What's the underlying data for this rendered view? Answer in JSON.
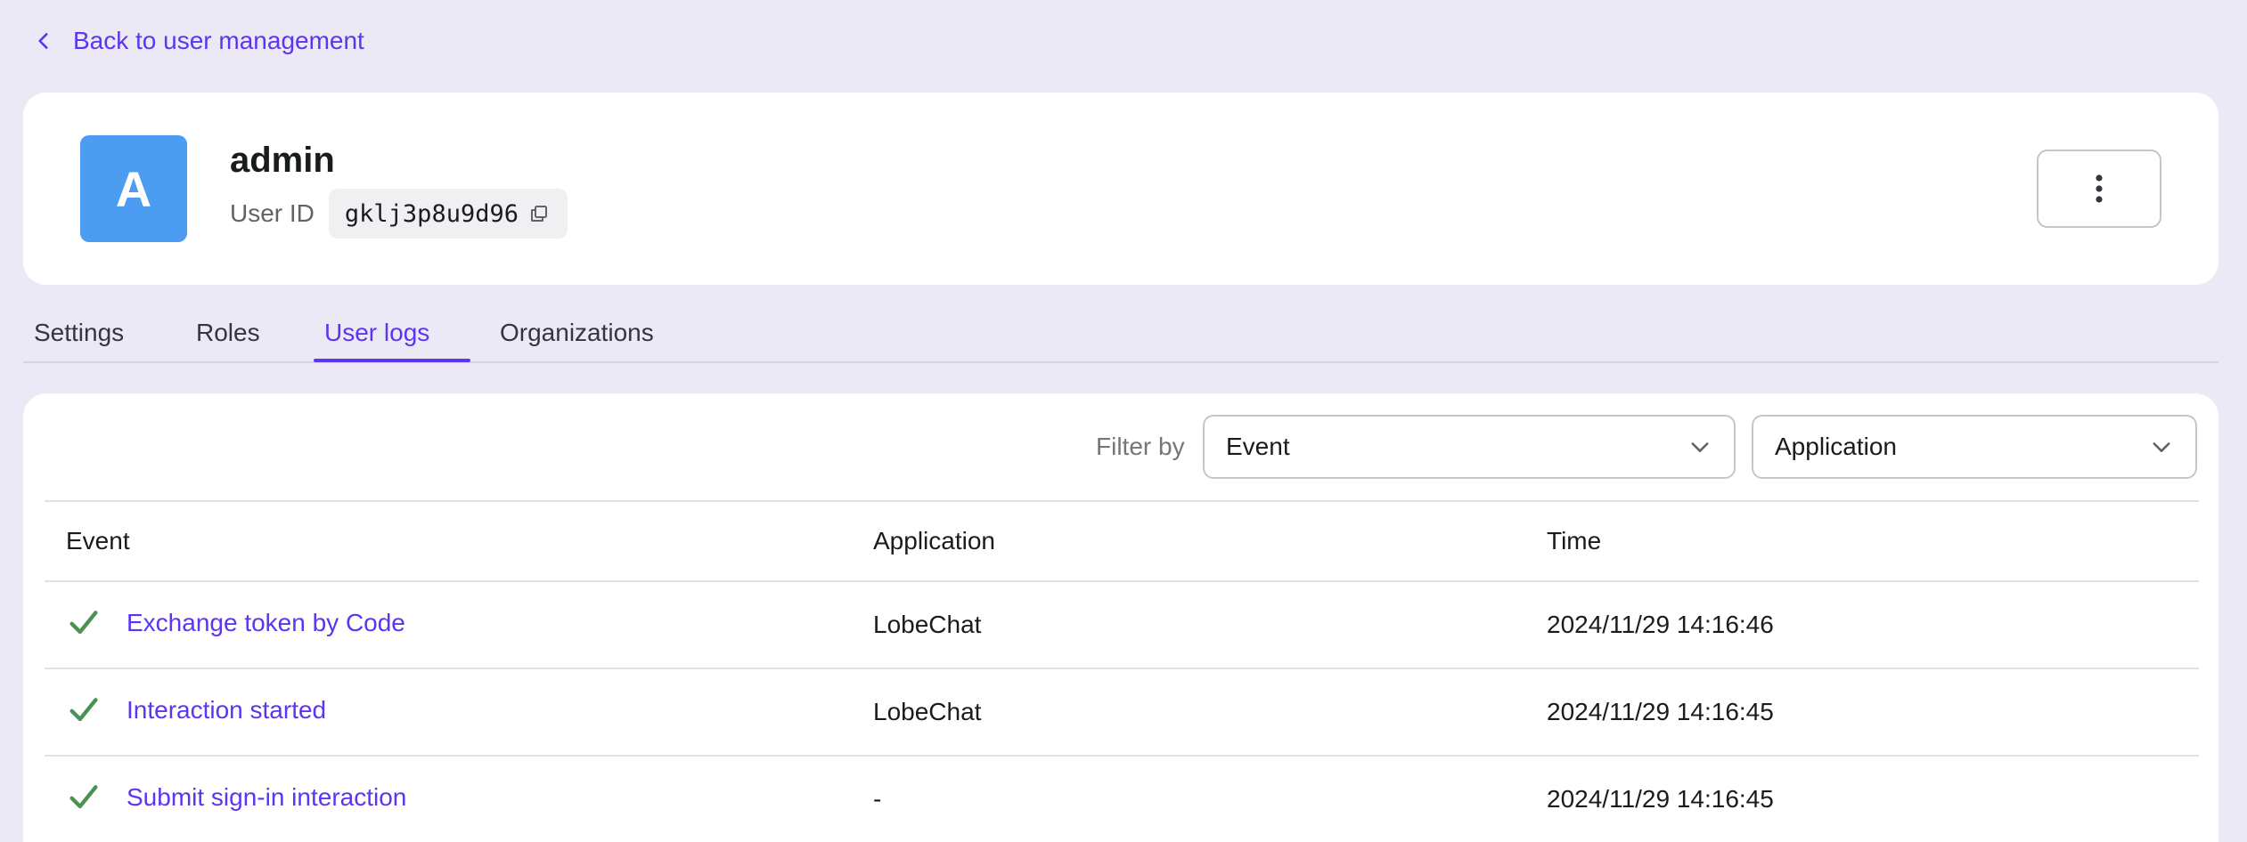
{
  "back_link": {
    "label": "Back to user management"
  },
  "user": {
    "avatar_letter": "A",
    "name": "admin",
    "id_label": "User ID",
    "id_value": "gklj3p8u9d96"
  },
  "tabs": [
    {
      "label": "Settings",
      "active": false
    },
    {
      "label": "Roles",
      "active": false
    },
    {
      "label": "User logs",
      "active": true
    },
    {
      "label": "Organizations",
      "active": false
    }
  ],
  "filters": {
    "label": "Filter by",
    "event_value": "Event",
    "application_value": "Application"
  },
  "table": {
    "columns": [
      "Event",
      "Application",
      "Time"
    ],
    "rows": [
      {
        "event": "Exchange token by Code",
        "application": "LobeChat",
        "time": "2024/11/29 14:16:46",
        "status": "success"
      },
      {
        "event": "Interaction started",
        "application": "LobeChat",
        "time": "2024/11/29 14:16:45",
        "status": "success"
      },
      {
        "event": "Submit sign-in interaction",
        "application": "-",
        "time": "2024/11/29 14:16:45",
        "status": "success"
      }
    ]
  },
  "colors": {
    "accent": "#5d34f2",
    "avatar": "#4c9df2",
    "success": "#4b9151",
    "background": "#ebe9f5"
  },
  "icons": {
    "back": "chevron-left-icon",
    "copy": "copy-icon",
    "more": "more-vertical-icon",
    "dropdown": "chevron-down-icon",
    "status": "check-icon"
  }
}
